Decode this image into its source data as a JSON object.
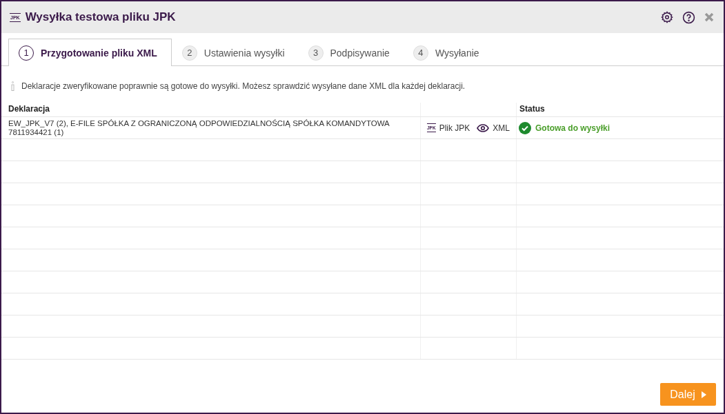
{
  "window": {
    "icon_text": "JPK",
    "title": "Wysyłka testowa pliku JPK"
  },
  "tabs": [
    {
      "number": "1",
      "label": "Przygotowanie pliku XML",
      "selected": true
    },
    {
      "number": "2",
      "label": "Ustawienia wysyłki",
      "selected": false
    },
    {
      "number": "3",
      "label": "Podpisywanie",
      "selected": false
    },
    {
      "number": "4",
      "label": "Wysyłanie",
      "selected": false
    }
  ],
  "info": "Deklaracje zweryfikowane poprawnie są gotowe do wysyłki. Możesz sprawdzić wysyłane dane XML dla każdej deklaracji.",
  "table": {
    "columns": [
      "Deklaracja",
      "Status"
    ],
    "rows": [
      {
        "declaration": "EW_JPK_V7 (2), E-FILE SPÓŁKA Z OGRANICZONĄ ODPOWIEDZIALNOŚCIĄ SPÓŁKA KOMANDYTOWA 7811934421 (1)",
        "jpk_icon_text": "JPK",
        "jpk_link": "Plik JPK",
        "xml_link": "XML",
        "status": {
          "kind": "ok",
          "text": "Gotowa do wysyłki"
        }
      }
    ]
  },
  "buttons": {
    "next": "Dalej"
  }
}
